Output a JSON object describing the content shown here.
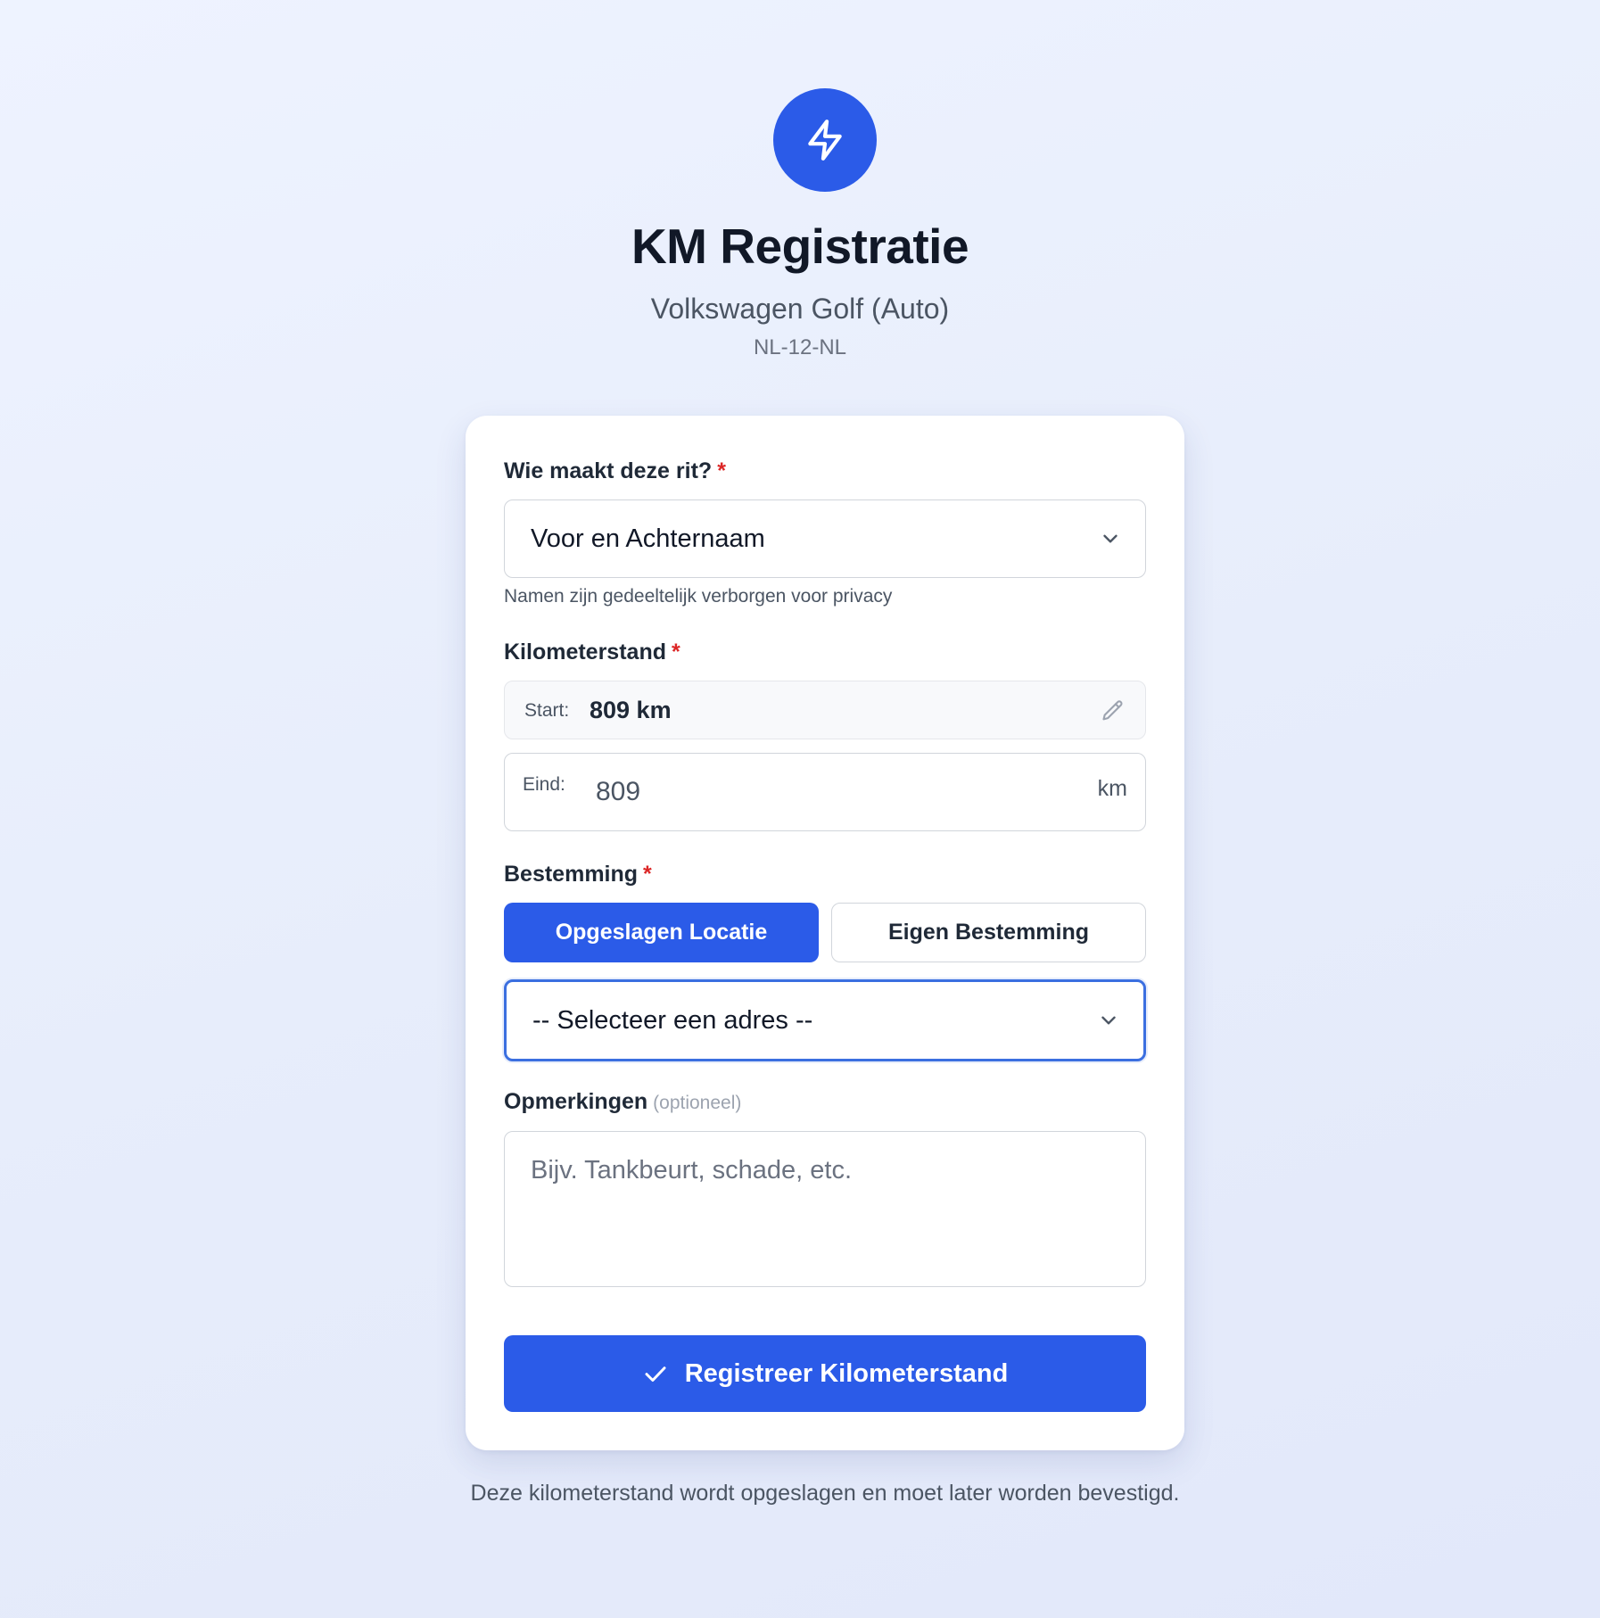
{
  "header": {
    "logo_icon": "lightning-bolt-icon",
    "title": "KM Registratie",
    "vehicle": "Volkswagen Golf (Auto)",
    "plate": "NL-12-NL"
  },
  "form": {
    "driver": {
      "label": "Wie maakt deze rit?",
      "required_mark": "*",
      "selected": "Voor en Achternaam",
      "hint": "Namen zijn gedeeltelijk verborgen voor privacy"
    },
    "odometer": {
      "label": "Kilometerstand",
      "required_mark": "*",
      "start_label": "Start:",
      "start_value": "809 km",
      "end_label": "Eind:",
      "end_placeholder": "809",
      "end_unit": "km"
    },
    "destination": {
      "label": "Bestemming",
      "required_mark": "*",
      "tab_saved": "Opgeslagen Locatie",
      "tab_custom": "Eigen Bestemming",
      "active_tab": "saved",
      "selected": "-- Selecteer een adres --"
    },
    "notes": {
      "label": "Opmerkingen",
      "optional": "(optioneel)",
      "placeholder": "Bijv. Tankbeurt, schade, etc."
    },
    "submit_label": "Registreer Kilometerstand"
  },
  "footer_text": "Deze kilometerstand wordt opgeslagen en moet later worden bevestigd.",
  "colors": {
    "primary": "#2b5be8",
    "required": "#dc2626",
    "focus": "#3b6fe0"
  }
}
